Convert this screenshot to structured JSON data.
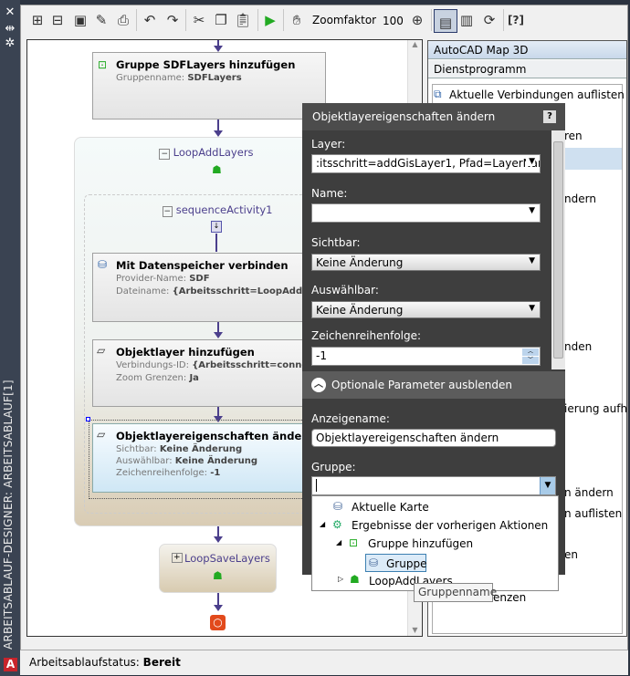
{
  "sidebar": {
    "title": "ARBEITSABLAUF-DESIGNER: ARBEITSABLAUF[1]",
    "icons": [
      "close-icon",
      "pin-icon",
      "gear-icon"
    ],
    "app_icon": "A"
  },
  "toolbar": {
    "zoom_label": "Zoomfaktor",
    "zoom_value": "100%",
    "items": [
      "new-workflow-icon",
      "open-workflow-icon",
      "save-icon",
      "save-as-icon",
      "print-icon",
      "undo-icon",
      "redo-icon",
      "cut-icon",
      "copy-icon",
      "paste-icon",
      "run-icon",
      "pan-icon",
      "zoom-fit-icon",
      "properties-view-icon",
      "toolbox-view-icon",
      "refresh-icon",
      "help-icon"
    ]
  },
  "workflow": {
    "group_add": {
      "title": "Gruppe SDFLayers hinzufügen",
      "prop_label": "Gruppenname:",
      "prop_value": "SDFLayers"
    },
    "loop1": {
      "title": "LoopAddLayers"
    },
    "sequence": {
      "title": "sequenceActivity1"
    },
    "connect": {
      "title": "Mit Datenspeicher verbinden",
      "props": [
        {
          "label": "Provider-Name:",
          "value": "SDF"
        },
        {
          "label": "Dateiname:",
          "value": "{Arbeitsschritt=LoopAddLayers..."
        }
      ]
    },
    "addlayer": {
      "title": "Objektlayer hinzufügen",
      "props": [
        {
          "label": "Verbindungs-ID:",
          "value": "{Arbeitsschritt=connectTo..."
        },
        {
          "label": "Zoom Grenzen:",
          "value": "Ja"
        }
      ]
    },
    "changeprops": {
      "title": "Objektlayereigenschaften ändern",
      "props": [
        {
          "label": "Sichtbar:",
          "value": "Keine Änderung"
        },
        {
          "label": "Auswählbar:",
          "value": "Keine Änderung"
        },
        {
          "label": "Zeichenreihenfolge:",
          "value": "-1"
        }
      ]
    },
    "loop2": {
      "title": "LoopSaveLayers"
    }
  },
  "right_panel": {
    "header1": "AutoCAD Map 3D",
    "header2": "Dienstprogramm",
    "items": [
      "Aktuelle Verbindungen auflisten",
      "ren",
      "ndern",
      "nden",
      "ierung aufh",
      "n ändern",
      "n auflisten",
      "en",
      "enzen"
    ]
  },
  "status": {
    "label": "Arbeitsablaufstatus:",
    "value": "Bereit"
  },
  "dialog": {
    "title": "Objektlayereigenschaften ändern",
    "help": "?",
    "layer_label": "Layer:",
    "layer_value": ":itsschritt=addGisLayer1, Pfad=LayerName}",
    "name_label": "Name:",
    "name_value": "",
    "visible_label": "Sichtbar:",
    "visible_value": "Keine Änderung",
    "selectable_label": "Auswählbar:",
    "selectable_value": "Keine Änderung",
    "order_label": "Zeichenreihenfolge:",
    "order_value": "-1",
    "optional_toggle": "Optionale Parameter ausblenden",
    "display_label": "Anzeigename:",
    "display_value": "Objektlayereigenschaften ändern",
    "group_label": "Gruppe:",
    "group_value": ""
  },
  "popup": {
    "items": [
      "Aktuelle Karte",
      "Ergebnisse der vorherigen Aktionen",
      "Gruppe hinzufügen",
      "Gruppe",
      "LoopAddLayers"
    ]
  },
  "tooltip": "Gruppenname"
}
